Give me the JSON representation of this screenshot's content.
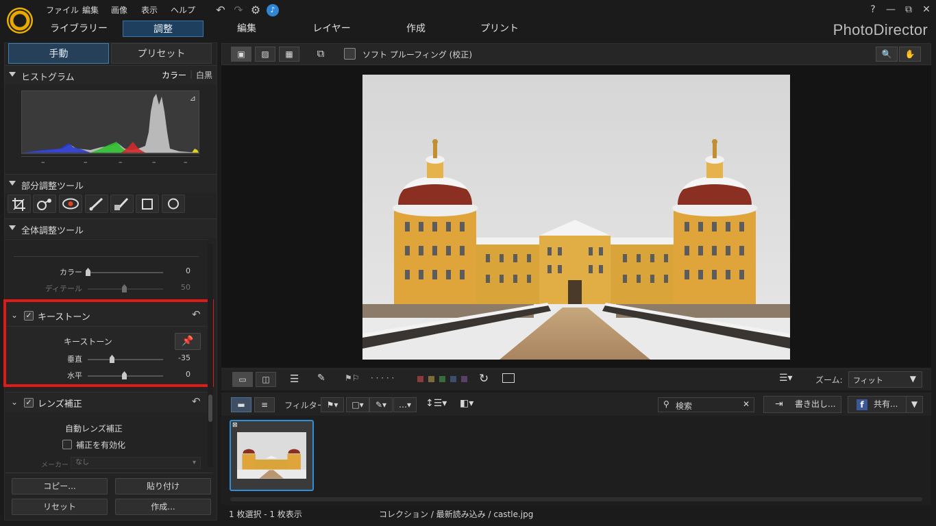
{
  "menu": [
    "ファイル",
    "編集",
    "画像",
    "表示",
    "ヘルプ"
  ],
  "window": {
    "help": "?",
    "minimize": "—",
    "maximize": "⧉",
    "close": "✕"
  },
  "modes": [
    "ライブラリー",
    "調整",
    "編集",
    "レイヤー",
    "作成",
    "プリント"
  ],
  "brand": "PhotoDirector",
  "colors": {
    "accent": "#2f8fd9",
    "highlight_box": "#e01919",
    "active_tab": "#1f3f5f"
  },
  "left": {
    "tabs": [
      "手動",
      "プリセット"
    ],
    "histogram": {
      "title": "ヒストグラム",
      "color": "カラー",
      "bw": "白黒",
      "ticks": [
        "–",
        "–",
        "–",
        "–",
        "–"
      ]
    },
    "local_tools": {
      "title": "部分調整ツール",
      "icons": [
        "crop-icon",
        "red-eye-spot-icon",
        "eye-icon",
        "brush-icon",
        "gradient-brush-icon",
        "rectangle-icon",
        "circle-icon"
      ]
    },
    "global_tools": {
      "title": "全体調整ツール"
    },
    "sliders_top": [
      {
        "label": "カラー",
        "value": "0",
        "pos": 0.0
      },
      {
        "label": "ディテール",
        "value": "50",
        "pos": 0.5
      }
    ],
    "keystone": {
      "title": "キーストーン",
      "sub_label": "キーストーン",
      "sliders": [
        {
          "label": "垂直",
          "value": "-35",
          "pos": 0.33
        },
        {
          "label": "水平",
          "value": "0",
          "pos": 0.5
        }
      ]
    },
    "lens": {
      "title": "レンズ補正",
      "auto_label": "自動レンズ補正",
      "enable_label": "補正を有効化",
      "maker_label": "メーカー",
      "maker_value": "なし"
    },
    "buttons": {
      "copy": "コピー...",
      "paste": "貼り付け",
      "reset": "リセット",
      "create": "作成..."
    }
  },
  "view": {
    "soft_proof": "ソフト プルーフィング (校正)",
    "zoom_label": "ズーム:",
    "zoom_value": "フィット",
    "filter_label": "フィルター:",
    "search_placeholder": "検索",
    "export_label": "書き出し...",
    "share_label": "共有...",
    "dots": "· · · · ·"
  },
  "status": {
    "selection": "1 枚選択 - 1 枚表示",
    "path": "コレクション / 最新読み込み / castle.jpg"
  }
}
